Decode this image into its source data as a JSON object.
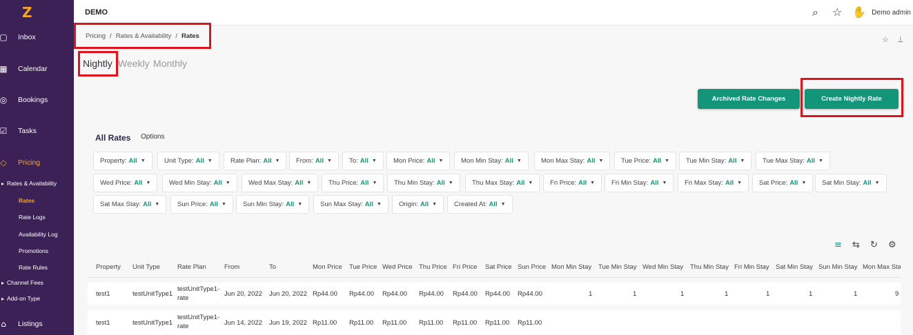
{
  "app": {
    "title": "DEMO",
    "user": "Demo admin"
  },
  "sidebar": {
    "logo": "Z",
    "items": [
      {
        "label": "Inbox",
        "icon": "chat-icon"
      },
      {
        "label": "Calendar",
        "icon": "calendar-icon"
      },
      {
        "label": "Bookings",
        "icon": "bookings-icon"
      },
      {
        "label": "Tasks",
        "icon": "tasks-icon"
      },
      {
        "label": "Pricing",
        "icon": "tag-icon"
      },
      {
        "label": "Listings",
        "icon": "home-icon"
      }
    ],
    "subitems": [
      "Rates & Availability",
      "Rates",
      "Rate Logs",
      "Availability Log",
      "Promotions",
      "Rate Rules",
      "Channel Fees",
      "Add-on Type"
    ]
  },
  "breadcrumb": {
    "items": [
      "Pricing",
      "Rates & Availability",
      "Rates"
    ],
    "sep": "/"
  },
  "tabs": [
    "Nightly",
    "Weekly",
    "Monthly"
  ],
  "buttons": {
    "archived": "Archived Rate Changes",
    "create": "Create Nightly Rate"
  },
  "section": {
    "title": "All Rates",
    "options": "Options"
  },
  "filters": [
    {
      "label": "Property:",
      "value": "All"
    },
    {
      "label": "Unit Type:",
      "value": "All"
    },
    {
      "label": "Rate Plan:",
      "value": "All"
    },
    {
      "label": "From:",
      "value": "All"
    },
    {
      "label": "To:",
      "value": "All"
    },
    {
      "label": "Mon Price:",
      "value": "All"
    },
    {
      "label": "Mon Min Stay:",
      "value": "All"
    },
    {
      "label": "Mon Max Stay:",
      "value": "All"
    },
    {
      "label": "Tue Price:",
      "value": "All"
    },
    {
      "label": "Tue Min Stay:",
      "value": "All"
    },
    {
      "label": "Tue Max Stay:",
      "value": "All"
    },
    {
      "label": "Wed Price:",
      "value": "All"
    },
    {
      "label": "Wed Min Stay:",
      "value": "All"
    },
    {
      "label": "Wed Max Stay:",
      "value": "All"
    },
    {
      "label": "Thu Price:",
      "value": "All"
    },
    {
      "label": "Thu Min Stay:",
      "value": "All"
    },
    {
      "label": "Thu Max Stay:",
      "value": "All"
    },
    {
      "label": "Fri Price:",
      "value": "All"
    },
    {
      "label": "Fri Min Stay:",
      "value": "All"
    },
    {
      "label": "Fri Max Stay:",
      "value": "All"
    },
    {
      "label": "Sat Price:",
      "value": "All"
    },
    {
      "label": "Sat Min Stay:",
      "value": "All"
    },
    {
      "label": "Sat Max Stay:",
      "value": "All"
    },
    {
      "label": "Sun Price:",
      "value": "All"
    },
    {
      "label": "Sun Min Stay:",
      "value": "All"
    },
    {
      "label": "Sun Max Stay:",
      "value": "All"
    },
    {
      "label": "Origin:",
      "value": "All"
    },
    {
      "label": "Created At:",
      "value": "All"
    }
  ],
  "table": {
    "columns": [
      "Property",
      "Unit Type",
      "Rate Plan",
      "From",
      "To",
      "Mon Price",
      "Tue Price",
      "Wed Price",
      "Thu Price",
      "Fri Price",
      "Sat Price",
      "Sun Price",
      "Mon Min Stay",
      "Tue Min Stay",
      "Wed Min Stay",
      "Thu Min Stay",
      "Fri Min Stay",
      "Sat Min Stay",
      "Sun Min Stay",
      "Mon Max Stay"
    ],
    "rows": [
      {
        "property": "test1",
        "unit_type": "testUnitType1",
        "rate_plan": "testUnitType1-rate",
        "from": "Jun 20, 2022",
        "to": "Jun 20, 2022",
        "prices": [
          "Rp44.00",
          "Rp44.00",
          "Rp44.00",
          "Rp44.00",
          "Rp44.00",
          "Rp44.00",
          "Rp44.00"
        ],
        "min_stays": [
          "1",
          "1",
          "1",
          "1",
          "1",
          "1",
          "1"
        ],
        "max_stay_partial": "9"
      },
      {
        "property": "test1",
        "unit_type": "testUnitType1",
        "rate_plan": "testUnitType1-rate",
        "from": "Jun 14, 2022",
        "to": "Jun 19, 2022",
        "prices": [
          "Rp11.00",
          "Rp11.00",
          "Rp11.00",
          "Rp11.00",
          "Rp11.00",
          "Rp11.00",
          "Rp11.00"
        ],
        "min_stays": [],
        "max_stay_partial": ""
      }
    ]
  }
}
